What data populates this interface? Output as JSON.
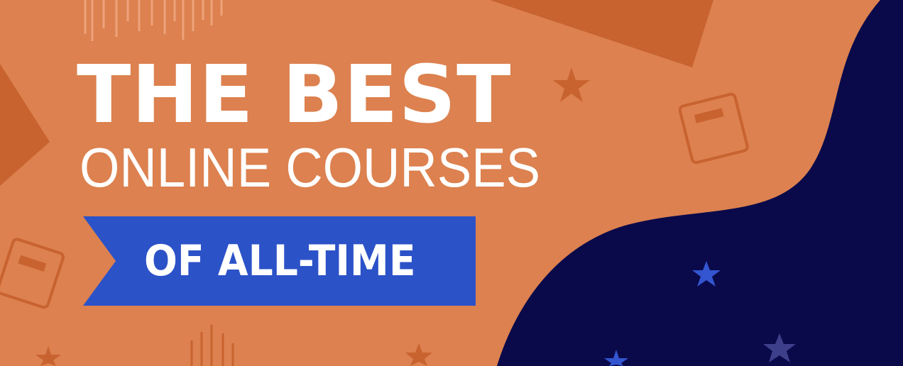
{
  "banner": {
    "title_line1": "THE BEST",
    "title_line2": "ONLINE COURSES",
    "ribbon_text": "OF ALL-TIME"
  },
  "colors": {
    "background": "#dc814f",
    "dark_shape": "#dc814f",
    "navy": "#0a0a4a",
    "ribbon_blue": "#2c52c8",
    "star_blue": "#3355d0",
    "text": "#ffffff"
  },
  "icons": [
    "star-icon",
    "book-icon",
    "barcode-lines"
  ]
}
